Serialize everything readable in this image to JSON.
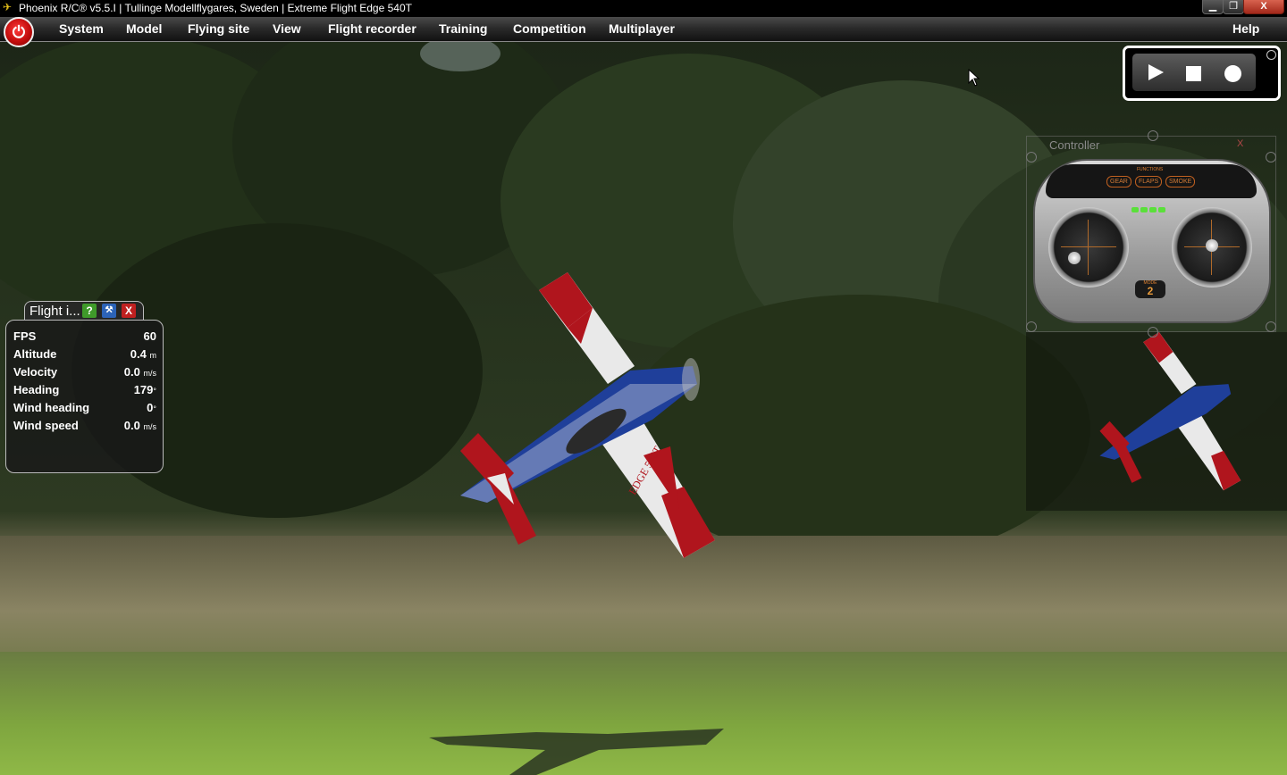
{
  "titlebar": {
    "title": "Phoenix R/C® v5.5.I  |  Tullinge Modellflygares, Sweden  |  Extreme Flight Edge 540T",
    "minimize_label": "▁",
    "restore_label": "❐",
    "close_label": "X"
  },
  "menubar": {
    "items": [
      {
        "label": "System"
      },
      {
        "label": "Model"
      },
      {
        "label": "Flying site"
      },
      {
        "label": "View"
      },
      {
        "label": "Flight recorder"
      },
      {
        "label": "Training"
      },
      {
        "label": "Competition"
      },
      {
        "label": "Multiplayer"
      }
    ],
    "help_label": "Help"
  },
  "controller": {
    "title": "Controller",
    "close_label": "X",
    "functions_label": "FUNCTIONS",
    "function_buttons": [
      "GEAR",
      "FLAPS",
      "SMOKE"
    ],
    "mode_label": "MODE",
    "mode_value": "2"
  },
  "flight_info": {
    "title": "Flight i...",
    "help_label": "?",
    "close_label": "X",
    "rows": [
      {
        "label": "FPS",
        "value": "60",
        "unit": ""
      },
      {
        "label": "Altitude",
        "value": "0.4",
        "unit": "m"
      },
      {
        "label": "Velocity",
        "value": "0.0",
        "unit": "m/s"
      },
      {
        "label": "Heading",
        "value": "179",
        "unit": "°"
      },
      {
        "label": "Wind heading",
        "value": "0",
        "unit": "°"
      },
      {
        "label": "Wind speed",
        "value": "0.0",
        "unit": "m/s"
      }
    ]
  },
  "aircraft": {
    "wing_text": "EDGE 540T"
  },
  "colors": {
    "aircraft_red": "#b0151d",
    "aircraft_blue": "#1f3f9a",
    "aircraft_white": "#e9e9e9",
    "power_button_red": "#c40d0d"
  }
}
